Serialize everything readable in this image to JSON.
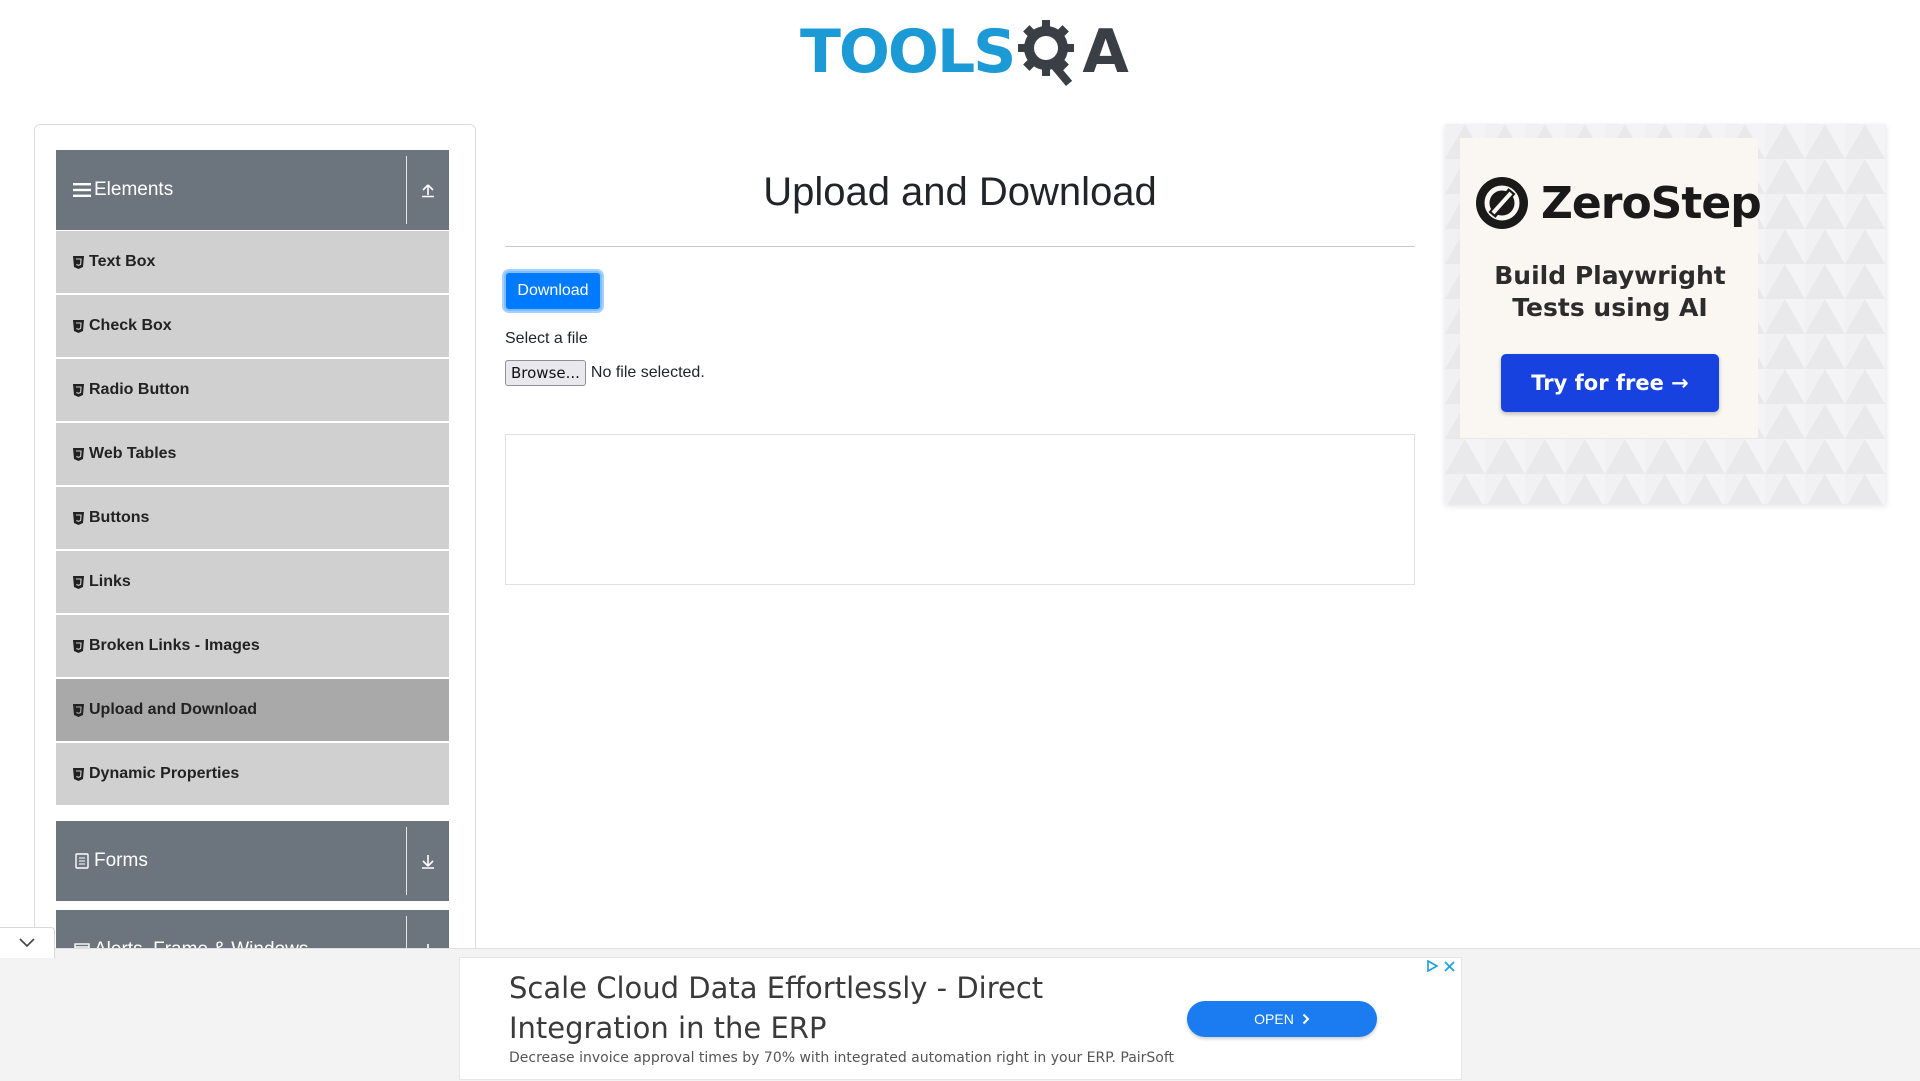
{
  "header": {
    "logo_left": "TOOLS",
    "logo_right": "A"
  },
  "sidebar": {
    "groups": [
      {
        "label": "Elements",
        "icon": "hamburger-icon",
        "arrow": "arrow-up-icon"
      },
      {
        "label": "Forms",
        "icon": "document-icon",
        "arrow": "arrow-down-icon"
      },
      {
        "label": "Alerts, Frame & Windows",
        "icon": "window-icon",
        "arrow": "arrow-down-icon"
      }
    ],
    "items": [
      {
        "label": "Text Box"
      },
      {
        "label": "Check Box"
      },
      {
        "label": "Radio Button"
      },
      {
        "label": "Web Tables"
      },
      {
        "label": "Buttons"
      },
      {
        "label": "Links"
      },
      {
        "label": "Broken Links - Images"
      },
      {
        "label": "Upload and Download",
        "active": true
      },
      {
        "label": "Dynamic Properties"
      }
    ]
  },
  "main": {
    "title": "Upload and Download",
    "download_label": "Download",
    "select_label": "Select a file",
    "browse_label": "Browse...",
    "file_status": "No file selected."
  },
  "side_ad": {
    "brand": "ZeroStep",
    "tagline_line1": "Build Playwright",
    "tagline_line2": "Tests using AI",
    "cta": "Try for free →"
  },
  "bottom_ad": {
    "headline": "Scale Cloud Data Effortlessly - Direct Integration in the ERP",
    "description": "Decrease invoice approval times by 70% with integrated automation right in your ERP. PairSoft",
    "cta": "OPEN"
  },
  "colors": {
    "primary": "#007bff",
    "sidebar_header": "#6c757d",
    "sidebar_item": "#d0d0d0",
    "sidebar_item_active": "#a9a9a9",
    "logo_blue": "#1c9ad6",
    "zerostep_button": "#1742e0"
  }
}
